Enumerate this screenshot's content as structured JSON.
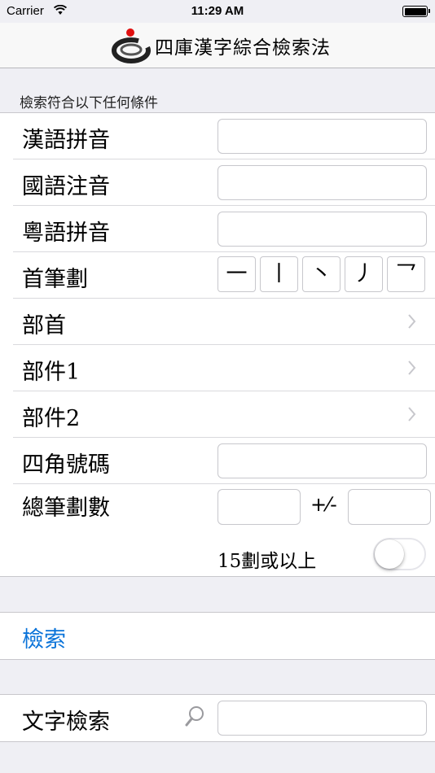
{
  "status_bar": {
    "carrier": "Carrier",
    "time": "11:29 AM",
    "wifi_icon": "wifi-icon",
    "battery_icon": "battery-icon",
    "battery_level": 1.0
  },
  "nav": {
    "title": "四庫漢字綜合檢索法",
    "logo_icon": "ink-swirl-logo"
  },
  "criteria": {
    "header": "檢索符合以下任何條件",
    "pinyin_label": "漢語拼音",
    "zhuyin_label": "國語注音",
    "jyutping_label": "粵語拼音",
    "first_stroke_label": "首筆劃",
    "first_strokes": [
      "一",
      "丨",
      "丶",
      "丿",
      "乛"
    ],
    "radical_label": "部首",
    "component1_label": "部件1",
    "component2_label": "部件2",
    "four_corner_label": "四角號碼",
    "total_strokes_label": "總筆劃數",
    "plus_minus": "+⁄-",
    "over15_label": "15劃或以上",
    "over15_enabled": false
  },
  "actions": {
    "search_label": "檢索"
  },
  "text_search": {
    "label": "文字檢索",
    "icon": "magnifier-icon"
  },
  "colors": {
    "accent": "#0a73d9",
    "background": "#efeff4",
    "separator": "#c8c7cc"
  }
}
